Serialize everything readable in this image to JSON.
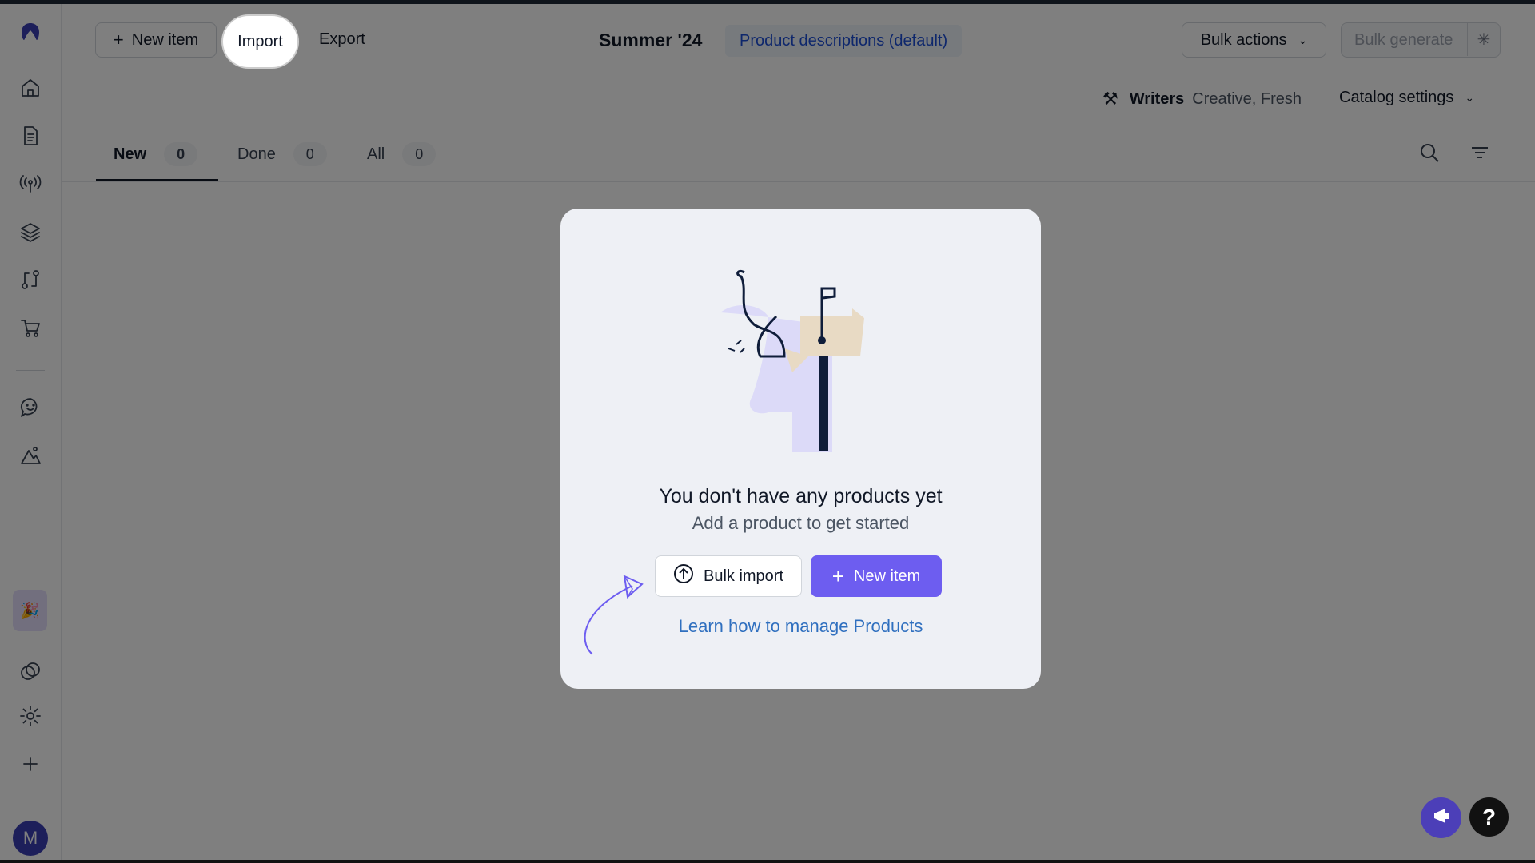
{
  "header": {
    "new_item_label": "New item",
    "import_label": "Import",
    "export_label": "Export",
    "catalog_name": "Summer '24",
    "template_pill": "Product descriptions (default)",
    "bulk_actions_label": "Bulk actions",
    "bulk_generate_label": "Bulk generate",
    "writers_label": "Writers",
    "writers_value": "Creative, Fresh",
    "catalog_settings_label": "Catalog settings"
  },
  "tabs": [
    {
      "label": "New",
      "count": "0"
    },
    {
      "label": "Done",
      "count": "0"
    },
    {
      "label": "All",
      "count": "0"
    }
  ],
  "sidebar": {
    "avatar_letter": "M",
    "icons": [
      "logo-icon",
      "home-icon",
      "document-icon",
      "broadcast-icon",
      "layers-icon",
      "flow-icon",
      "cart-icon",
      "chat-icon",
      "image-icon",
      "party-icon",
      "circles-icon",
      "gear-icon",
      "plus-icon"
    ]
  },
  "modal": {
    "title": "You don't have any products yet",
    "subtitle": "Add a product to get started",
    "bulk_import_label": "Bulk import",
    "new_item_label": "New item",
    "learn_link": "Learn how to manage Products"
  },
  "help_label": "?",
  "colors": {
    "accent": "#6d5df0",
    "link": "#2f6fbf",
    "overlay": "rgba(0,0,0,0.5)"
  }
}
